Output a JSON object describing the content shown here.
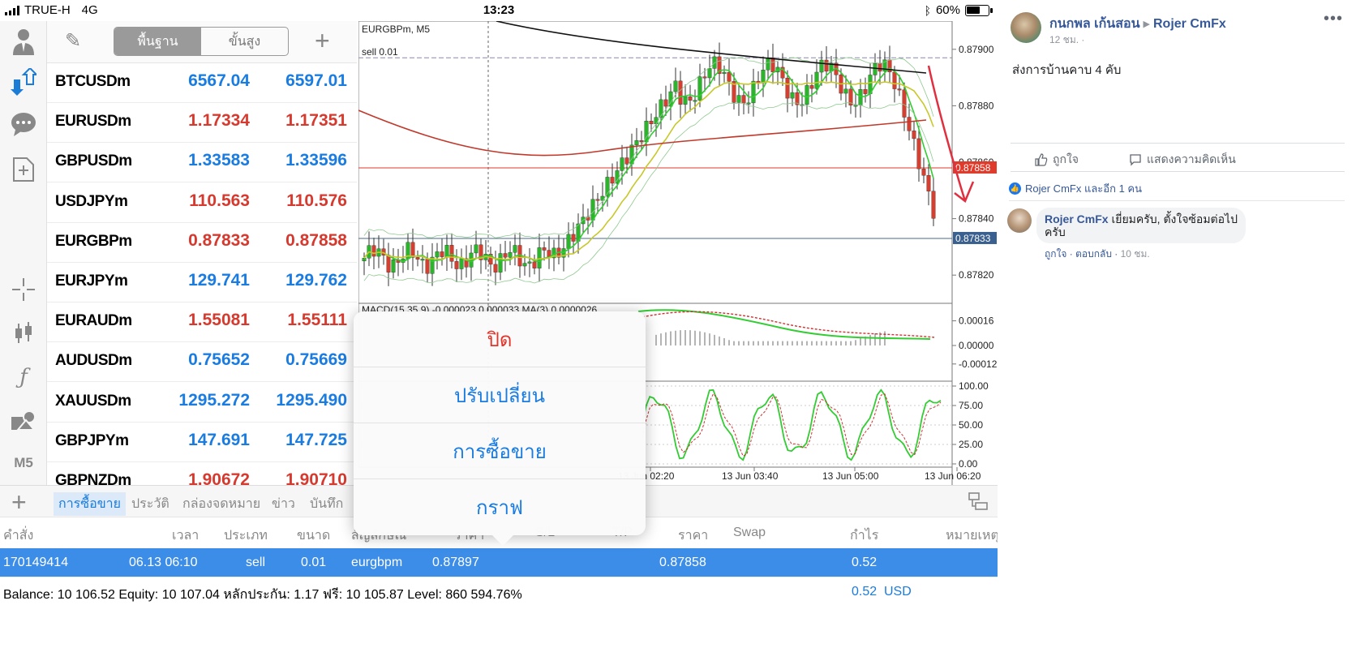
{
  "status_bar": {
    "carrier": "TRUE-H",
    "network": "4G",
    "time": "13:23",
    "battery": "60%"
  },
  "quotes_toolbar": {
    "segments": [
      "พื้นฐาน",
      "ขั้นสูง"
    ],
    "active_segment": 0
  },
  "quotes": [
    {
      "symbol": "BTCUSDm",
      "bid": "6567.04",
      "ask": "6597.01",
      "dir": "up"
    },
    {
      "symbol": "EURUSDm",
      "bid": "1.17334",
      "ask": "1.17351",
      "dir": "down"
    },
    {
      "symbol": "GBPUSDm",
      "bid": "1.33583",
      "ask": "1.33596",
      "dir": "up"
    },
    {
      "symbol": "USDJPYm",
      "bid": "110.563",
      "ask": "110.576",
      "dir": "down"
    },
    {
      "symbol": "EURGBPm",
      "bid": "0.87833",
      "ask": "0.87858",
      "dir": "down"
    },
    {
      "symbol": "EURJPYm",
      "bid": "129.741",
      "ask": "129.762",
      "dir": "up"
    },
    {
      "symbol": "EURAUDm",
      "bid": "1.55081",
      "ask": "1.55111",
      "dir": "down"
    },
    {
      "symbol": "AUDUSDm",
      "bid": "0.75652",
      "ask": "0.75669",
      "dir": "up"
    },
    {
      "symbol": "XAUUSDm",
      "bid": "1295.272",
      "ask": "1295.490",
      "dir": "up"
    },
    {
      "symbol": "GBPJPYm",
      "bid": "147.691",
      "ask": "147.725",
      "dir": "up"
    },
    {
      "symbol": "GBPNZDm",
      "bid": "1.90672",
      "ask": "1.90710",
      "dir": "down"
    }
  ],
  "sidebar": {
    "timeframe": "M5"
  },
  "chart": {
    "title": "EURGBPm, M5",
    "order_label": "sell 0.01",
    "price_ticks": [
      "0.87900",
      "0.87880",
      "0.87860",
      "0.87840",
      "0.87820"
    ],
    "ask_label": "0.87858",
    "bid_label": "0.87833",
    "macd_label": "MACD(15,35,9) -0.000023 0.000033 MA(3) 0.0000026",
    "macd_ticks": [
      "0.00016",
      "0.00000",
      "-0.00012"
    ],
    "stoch_ticks": [
      "100.00",
      "75.00",
      "50.00",
      "25.00",
      "0.00"
    ],
    "time_labels": [
      "13 Jun 02:20",
      "13 Jun 03:40",
      "13 Jun 05:00",
      "13 Jun 06:20"
    ],
    "colors": {
      "bull": "#22bb22",
      "bear": "#e03a2a",
      "ma_long": "#c0392b",
      "ma_black": "#111111",
      "ma_fast": "#33cc33",
      "ma_yellow": "#c8c82a",
      "bollinger": "#8fc98f",
      "annotation": "#e03040"
    }
  },
  "bottom_tabs": {
    "items": [
      "การซื้อขาย",
      "ประวัติ",
      "กล่องจดหมาย",
      "ข่าว",
      "บันทึก"
    ],
    "active": 0
  },
  "trade_table": {
    "columns": [
      "คำสั่ง",
      "เวลา",
      "ประเภท",
      "ขนาด",
      "สัญลักษณ์",
      "ราคา",
      "S/L",
      "T/P",
      "ราคา",
      "Swap",
      "กำไร",
      "หมายเหตุ"
    ],
    "row": {
      "ticket": "170149414",
      "time": "06.13 06:10",
      "type": "sell",
      "volume": "0.01",
      "symbol": "eurgbpm",
      "open_price": "0.87897",
      "price": "0.87858",
      "profit": "0.52"
    }
  },
  "balance": {
    "text": "Balance: 10 106.52 Equity: 10 107.04 หลักประกัน: 1.17 ฟรี: 10 105.87 Level: 860 594.76%",
    "profit": "0.52",
    "currency": "USD"
  },
  "context_menu": {
    "items": [
      "ปิด",
      "ปรับเปลี่ยน",
      "การซื้อขาย",
      "กราฟ"
    ]
  },
  "facebook": {
    "author": "กนกพล เก้นสอน",
    "target": "Rojer CmFx",
    "time": "12 ชม.",
    "post_text": "ส่งการบ้านคาบ 4 คับ",
    "like_label": "ถูกใจ",
    "comment_label": "แสดงความคิดเห็น",
    "likes_text": "Rojer CmFx และอีก 1 คน",
    "comment": {
      "name": "Rojer CmFx",
      "text": "เยี่ยมครับ, ตั้งใจซ้อมต่อไปครับ",
      "like": "ถูกใจ",
      "reply": "ตอบกลับ",
      "time": "10 ชม."
    }
  }
}
